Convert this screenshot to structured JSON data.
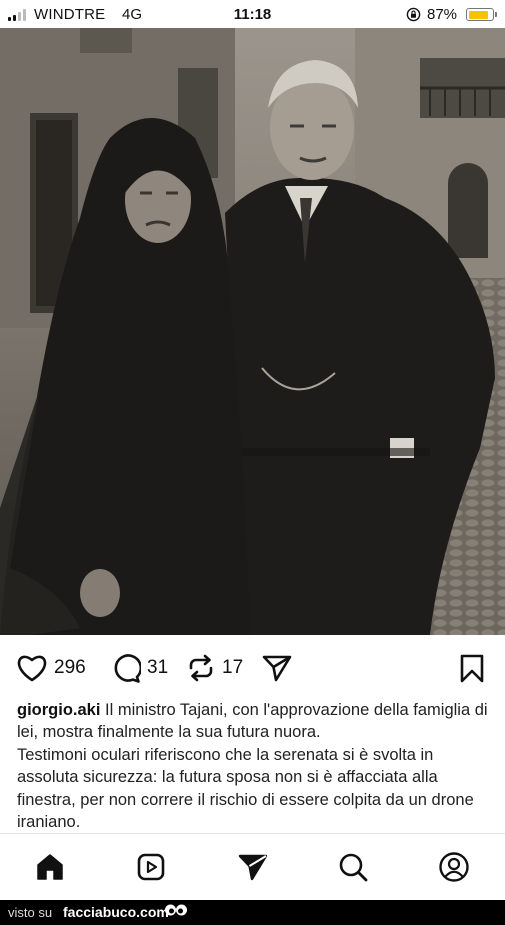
{
  "status_bar": {
    "carrier": "WINDTRE",
    "network": "4G",
    "time": "11:18",
    "battery_percent_text": "87%",
    "battery_level": 0.87,
    "battery_color": "#f2c500"
  },
  "post": {
    "image_icon": "photo",
    "actions": {
      "like_icon": "heart-icon",
      "likes": "296",
      "comment_icon": "comment-bubble-icon",
      "comments": "31",
      "repost_icon": "repost-icon",
      "reposts": "17",
      "share_icon": "send-icon",
      "save_icon": "bookmark-icon"
    },
    "caption": {
      "username": "giorgio.aki",
      "text_1": "Il ministro Tajani, con l'approvazione della famiglia di lei, mostra finalmente la sua futura nuora.",
      "text_2": "Testimoni oculari riferiscono che la serenata si è svolta in assoluta sicurezza: la futura sposa non si è affacciata alla finestra, per non correre il rischio di essere colpita da un drone iraniano."
    }
  },
  "bottom_nav": [
    {
      "icon": "home-icon"
    },
    {
      "icon": "reels-icon"
    },
    {
      "icon": "send-icon"
    },
    {
      "icon": "search-icon"
    },
    {
      "icon": "profile-icon"
    }
  ],
  "watermark": {
    "prefix": "visto su",
    "brand": "facciabuco.com"
  }
}
